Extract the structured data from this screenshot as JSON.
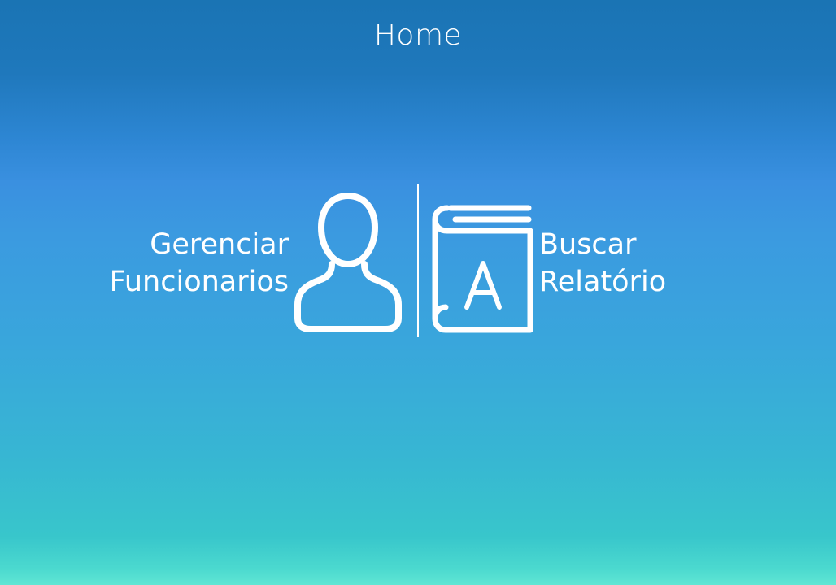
{
  "header": {
    "title": "Home"
  },
  "menu": {
    "employees": {
      "label_line1": "Gerenciar",
      "label_line2": "Funcionarios",
      "icon": "user-icon"
    },
    "reports": {
      "label_line1": "Buscar",
      "label_line2": "Relatório",
      "icon": "book-icon",
      "icon_letter": "A"
    }
  },
  "colors": {
    "background_top": "#1a74b4",
    "background_middle": "#3a90e0",
    "background_bottom": "#5fe6d4",
    "foreground": "#ffffff"
  }
}
